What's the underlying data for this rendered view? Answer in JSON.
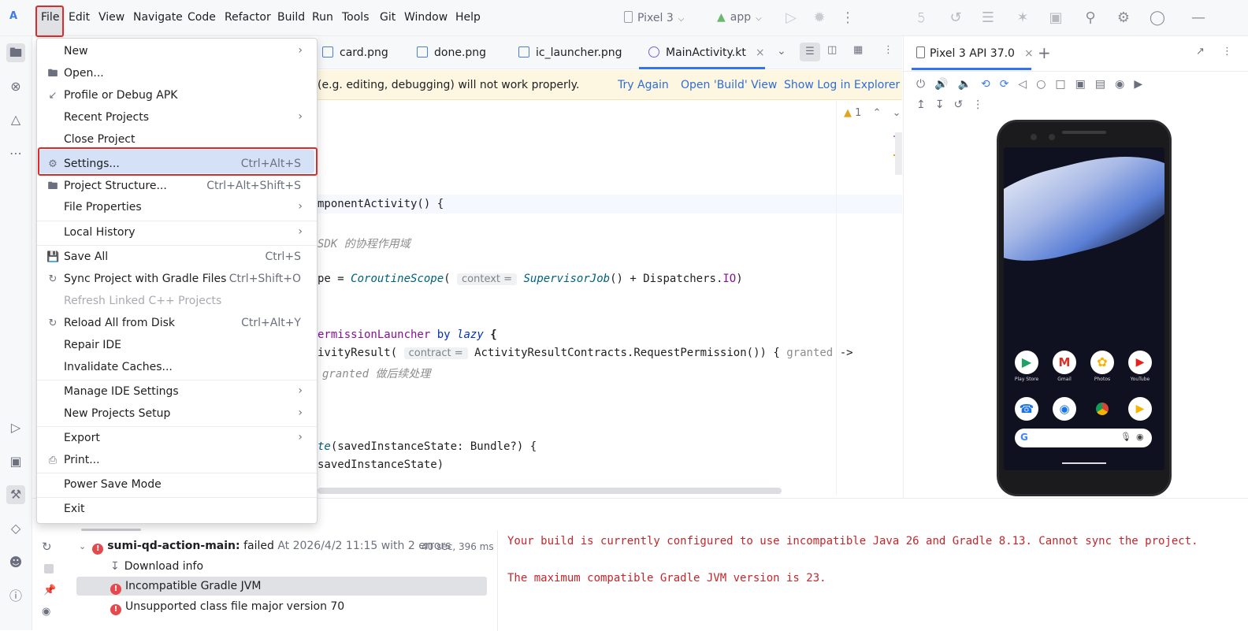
{
  "menubar": {
    "items": [
      "File",
      "Edit",
      "View",
      "Navigate",
      "Code",
      "Refactor",
      "Build",
      "Run",
      "Tools",
      "Git",
      "Window",
      "Help"
    ],
    "device": "Pixel 3",
    "config": "app"
  },
  "tabs": [
    "card.png",
    "done.png",
    "ic_launcher.png",
    "MainActivity.kt"
  ],
  "banner": {
    "message": "(e.g. editing, debugging) will not work properly.",
    "try_again": "Try Again",
    "open_build": "Open 'Build' View",
    "show_log": "Show Log in Explorer"
  },
  "editor": {
    "warning_count": "1",
    "lines": {
      "l1_fn": "mponentActivity() {",
      "l2_comment": "SDK 的协程作用域",
      "l3_pre": "pe = ",
      "l3_fn": "CoroutineScope",
      "l3_hint": "context =",
      "l3_fn2": "SupervisorJob",
      "l3_post": "() + Dispatchers.",
      "l3_io": "IO",
      "l3_end": ")",
      "l4_pre": "ermissionLauncher",
      "l4_by": "by",
      "l4_lazy": "lazy",
      "l4_brace": "{",
      "l5_pre": "ivityResult(",
      "l5_hint": "contract =",
      "l5_post": "ActivityResultContracts.RequestPermission()) {",
      "l5_granted": "granted",
      "l5_arrow": "->",
      "l6_comment": "granted 做后续处理",
      "l7_fn": "te",
      "l7_post": "(savedInstanceState: Bundle?) {",
      "l8": "savedInstanceState)"
    }
  },
  "file_menu": {
    "items": [
      {
        "label": "New",
        "shortcut": "",
        "submenu": true
      },
      {
        "label": "Open...",
        "shortcut": "",
        "submenu": false
      },
      {
        "label": "Profile or Debug APK",
        "shortcut": "",
        "submenu": false
      },
      {
        "label": "Recent Projects",
        "shortcut": "",
        "submenu": true
      },
      {
        "label": "Close Project",
        "shortcut": "",
        "submenu": false
      },
      {
        "label": "Settings...",
        "shortcut": "Ctrl+Alt+S",
        "submenu": false
      },
      {
        "label": "Project Structure...",
        "shortcut": "Ctrl+Alt+Shift+S",
        "submenu": false
      },
      {
        "label": "File Properties",
        "shortcut": "",
        "submenu": true
      },
      {
        "label": "Local History",
        "shortcut": "",
        "submenu": true
      },
      {
        "label": "Save All",
        "shortcut": "Ctrl+S",
        "submenu": false
      },
      {
        "label": "Sync Project with Gradle Files",
        "shortcut": "Ctrl+Shift+O",
        "submenu": false
      },
      {
        "label": "Refresh Linked C++ Projects",
        "shortcut": "",
        "submenu": false
      },
      {
        "label": "Reload All from Disk",
        "shortcut": "Ctrl+Alt+Y",
        "submenu": false
      },
      {
        "label": "Repair IDE",
        "shortcut": "",
        "submenu": false
      },
      {
        "label": "Invalidate Caches...",
        "shortcut": "",
        "submenu": false
      },
      {
        "label": "Manage IDE Settings",
        "shortcut": "",
        "submenu": true
      },
      {
        "label": "New Projects Setup",
        "shortcut": "",
        "submenu": true
      },
      {
        "label": "Export",
        "shortcut": "",
        "submenu": true
      },
      {
        "label": "Print...",
        "shortcut": "",
        "submenu": false
      },
      {
        "label": "Power Save Mode",
        "shortcut": "",
        "submenu": false
      },
      {
        "label": "Exit",
        "shortcut": "",
        "submenu": false
      }
    ]
  },
  "emulator": {
    "tab": "Pixel 3 API 37.0",
    "apps": [
      "Play Store",
      "Gmail",
      "Photos",
      "YouTube"
    ]
  },
  "build": {
    "root": "sumi-qd-action-main:",
    "status": "failed",
    "detail": "At 2026/4/2 11:15 with 2 errors",
    "duration": "40 sec, 396 ms",
    "children": [
      "Download info",
      "Incompatible Gradle JVM",
      "Unsupported class file major version 70"
    ],
    "console": [
      "Your build is currently configured to use incompatible Java 26 and Gradle 8.13. Cannot sync the project.",
      "The maximum compatible Gradle JVM version is 23."
    ]
  }
}
